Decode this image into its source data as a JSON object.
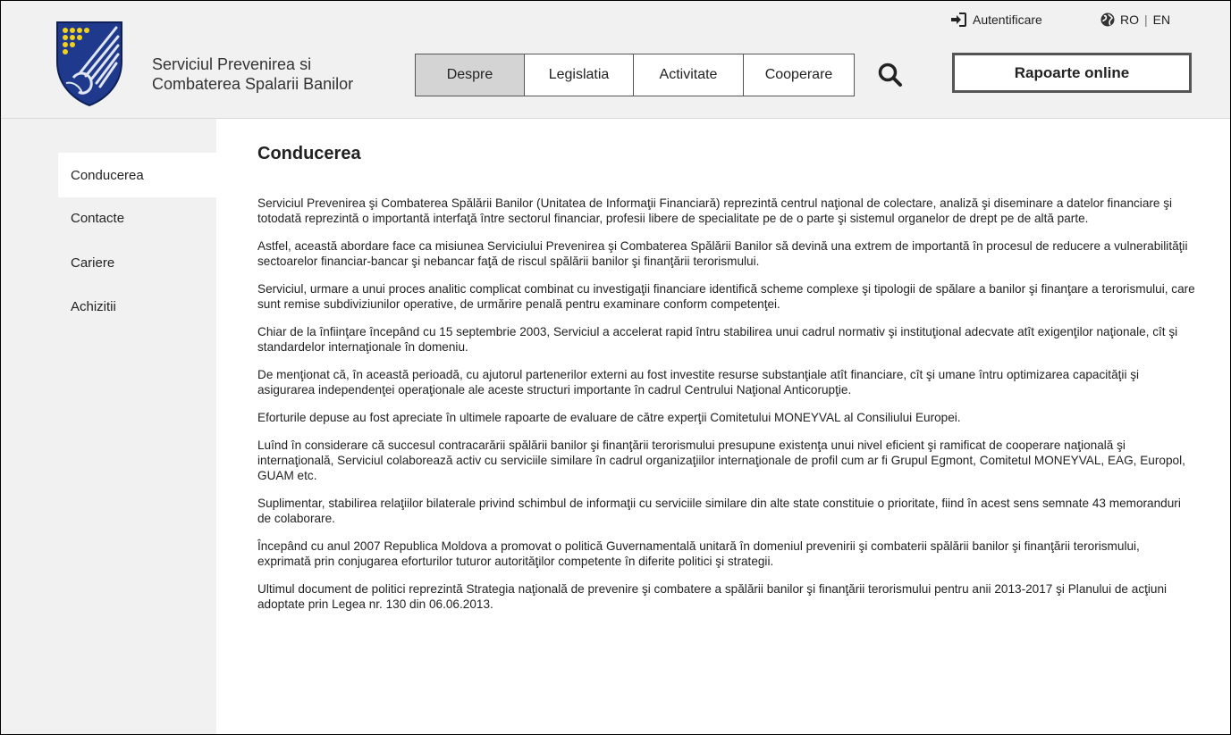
{
  "header": {
    "org_name_line1": "Serviciul Prevenirea si",
    "org_name_line2": "Combaterea Spalarii Banilor",
    "auth_label": "Autentificare",
    "lang_active": "RO",
    "lang_separator": "|",
    "lang_other": "EN",
    "reports_button": "Rapoarte online",
    "icons": {
      "auth": "sign-in-icon",
      "language": "globe-icon",
      "search": "search-icon",
      "logo": "coat-of-arms-logo"
    }
  },
  "nav": {
    "items": [
      {
        "label": "Despre",
        "active": true
      },
      {
        "label": "Legislatia",
        "active": false
      },
      {
        "label": "Activitate",
        "active": false
      },
      {
        "label": "Cooperare",
        "active": false
      }
    ]
  },
  "sidebar": {
    "items": [
      {
        "label": "Conducerea",
        "active": true
      },
      {
        "label": "Contacte",
        "active": false
      },
      {
        "label": "Cariere",
        "active": false
      },
      {
        "label": "Achizitii",
        "active": false
      }
    ]
  },
  "main": {
    "title": "Conducerea",
    "paragraphs": [
      "Serviciul Prevenirea şi Combaterea Spălării Banilor (Unitatea de Informaţii Financiară) reprezintă centrul naţional de colectare, analiză şi diseminare a datelor financiare şi totodată reprezintă o importantă interfaţă între sectorul financiar, profesii libere de specialitate pe de o parte şi sistemul organelor de drept pe de altă parte.",
      "Astfel, această abordare face ca misiunea Serviciului Prevenirea şi Combaterea Spălării Banilor să devină una extrem de importantă în procesul de reducere a vulnerabilităţii sectoarelor financiar-bancar şi nebancar faţă de riscul spălării banilor şi finanţării terorismului.",
      "Serviciul, urmare a unui proces analitic complicat combinat cu investigaţii financiare identifică scheme complexe şi tipologii de spălare a banilor şi finanţare a terorismului, care sunt remise subdiviziunilor operative, de urmărire penală pentru examinare conform competenţei.",
      "Chiar de la înfiinţare începând cu 15 septembrie 2003, Serviciul a accelerat rapid întru stabilirea unui cadrul normativ şi instituţional adecvate atît exigenţilor naţionale, cît şi standardelor internaţionale în domeniu.",
      "De menţionat că, în această perioadă, cu ajutorul partenerilor externi au fost investite resurse substanţiale atît financiare, cît şi umane întru optimizarea capacităţii şi asigurarea independenţei operaţionale ale aceste structuri importante în cadrul Centrului Naţional Anticorupţie.",
      "Eforturile depuse au fost apreciate în ultimele rapoarte de evaluare de către experţii Comitetului MONEYVAL al Consiliului Europei.",
      "Luînd în considerare că succesul contracarării spălării banilor şi finanţării terorismului presupune existenţa unui nivel eficient şi ramificat de cooperare naţională şi internaţională, Serviciul colaborează activ cu serviciile similare în cadrul organizaţiilor internaţionale de profil cum ar fi Grupul Egmont, Comitetul MONEYVAL, EAG, Europol, GUAM etc.",
      "Suplimentar, stabilirea relaţiilor bilaterale privind schimbul de informaţii cu serviciile similare din alte state constituie o prioritate, fiind în acest sens semnate 43 memoranduri de colaborare.",
      "Începând cu anul 2007 Republica Moldova a promovat o politică Guvernamentală unitară în domeniul prevenirii şi combaterii spălării banilor şi finanţării terorismului, exprimată prin conjugarea eforturilor tuturor autorităţilor competente în diferite politici şi strategii.",
      "Ultimul document de politici reprezintă Strategia naţională de prevenire şi combatere a spălării banilor şi finanţării terorismului pentru anii 2013-2017 şi Planului de acţiuni adoptate prin Legea nr. 130 din 06.06.2013."
    ]
  },
  "colors": {
    "header_bg": "#f1f1f1",
    "sidebar_bg": "#f1f1f1",
    "nav_active_bg": "#d4d4d4",
    "logo_blue": "#1f3a8c",
    "logo_gold": "#f2d21b"
  }
}
